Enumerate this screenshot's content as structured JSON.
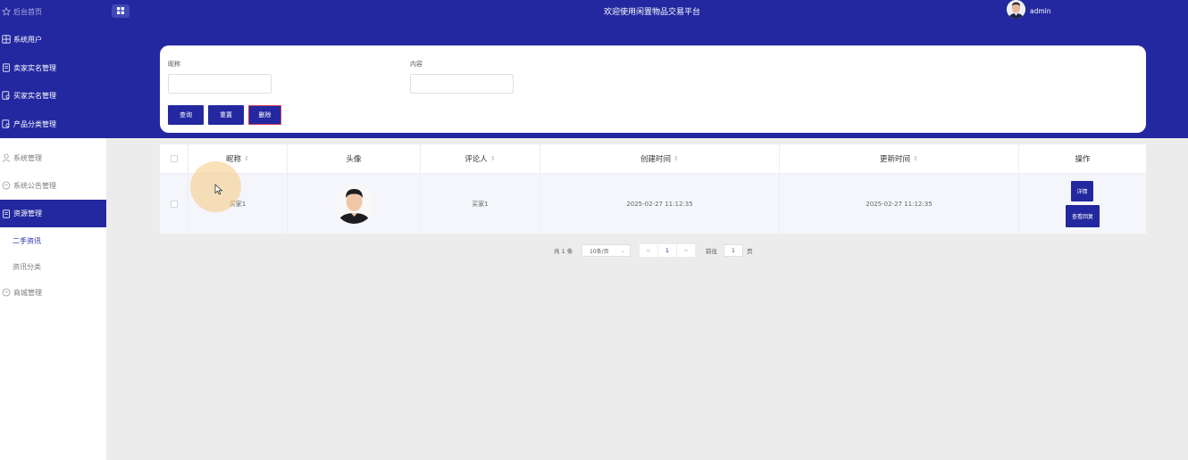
{
  "header": {
    "title": "欢迎使用闲置物品交易平台",
    "username": "admin"
  },
  "sidebar": {
    "items": [
      {
        "label": "后台首页",
        "icon": "star-icon"
      },
      {
        "label": "系统用户",
        "icon": "grid-icon"
      },
      {
        "label": "卖家实名管理",
        "icon": "document-icon"
      },
      {
        "label": "买家实名管理",
        "icon": "document-search-icon"
      },
      {
        "label": "产品分类管理",
        "icon": "document-search-icon"
      },
      {
        "label": "系统管理",
        "icon": "user-icon"
      },
      {
        "label": "系统公告管理",
        "icon": "chat-icon"
      },
      {
        "label": "资源管理",
        "icon": "document-icon"
      },
      {
        "label": "二手资讯"
      },
      {
        "label": "资讯分类"
      },
      {
        "label": "商城管理",
        "icon": "chat-icon"
      }
    ]
  },
  "search": {
    "nickname_label": "昵称",
    "nickname_value": "",
    "content_label": "内容",
    "content_value": "",
    "query_button": "查询",
    "reset_button": "重置",
    "delete_button": "删除"
  },
  "table": {
    "headers": [
      "昵称",
      "头像",
      "评论人",
      "创建时间",
      "更新时间",
      "操作"
    ],
    "sort_icon": "⇕",
    "rows": [
      {
        "nickname": "买家1",
        "commenter": "买家1",
        "created": "2025-02-27 11:12:35",
        "updated": "2025-02-27 11:12:35",
        "detail_button": "详情",
        "reply_button": "查看回复"
      }
    ]
  },
  "pagination": {
    "total": "共 1 条",
    "page_size": "10条/页",
    "prev": "<",
    "current_page": "1",
    "next": ">",
    "goto_label": "前往",
    "goto_value": "1",
    "page_unit": "页"
  },
  "colors": {
    "primary": "#2328a0",
    "delete_border": "#d23b55"
  }
}
